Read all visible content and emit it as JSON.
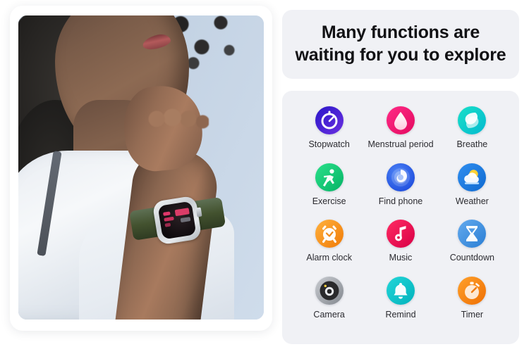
{
  "heading": {
    "line1": "Many functions are",
    "line2": "waiting for you to explore"
  },
  "photo": {
    "alt": "Woman in white shirt with hand to chin wearing a smartwatch with green band",
    "watch": {
      "case_color": "#d7dcdf",
      "band_color": "#4a5a33",
      "screen_accent": "#e0376b"
    }
  },
  "colors": {
    "page_background": "#ffffff",
    "panel_background": "#f0f1f5",
    "heading_text": "#111114",
    "label_text": "#2b2b30"
  },
  "features": [
    {
      "label": "Stopwatch",
      "icon": "stopwatch-icon",
      "color": "#3b1fd6"
    },
    {
      "label": "Menstrual period",
      "icon": "droplet-icon",
      "color": "#f01a6e"
    },
    {
      "label": "Breathe",
      "icon": "breathe-leaf-icon",
      "color": "#12cfc9"
    },
    {
      "label": "Exercise",
      "icon": "running-person-icon",
      "color": "#17c06a"
    },
    {
      "label": "Find phone",
      "icon": "find-phone-radar-icon",
      "color": "#2563eb"
    },
    {
      "label": "Weather",
      "icon": "sun-cloud-icon",
      "color": "#1f7fe0"
    },
    {
      "label": "Alarm clock",
      "icon": "alarm-clock-icon",
      "color": "#f79021"
    },
    {
      "label": "Music",
      "icon": "music-note-icon",
      "color": "#ea1152"
    },
    {
      "label": "Countdown",
      "icon": "hourglass-icon",
      "color": "#4896e0"
    },
    {
      "label": "Camera",
      "icon": "camera-lens-icon",
      "color": "#8e949b"
    },
    {
      "label": "Remind",
      "icon": "bell-icon",
      "color": "#14c4ca"
    },
    {
      "label": "Timer",
      "icon": "timer-icon",
      "color": "#f4820f"
    }
  ]
}
